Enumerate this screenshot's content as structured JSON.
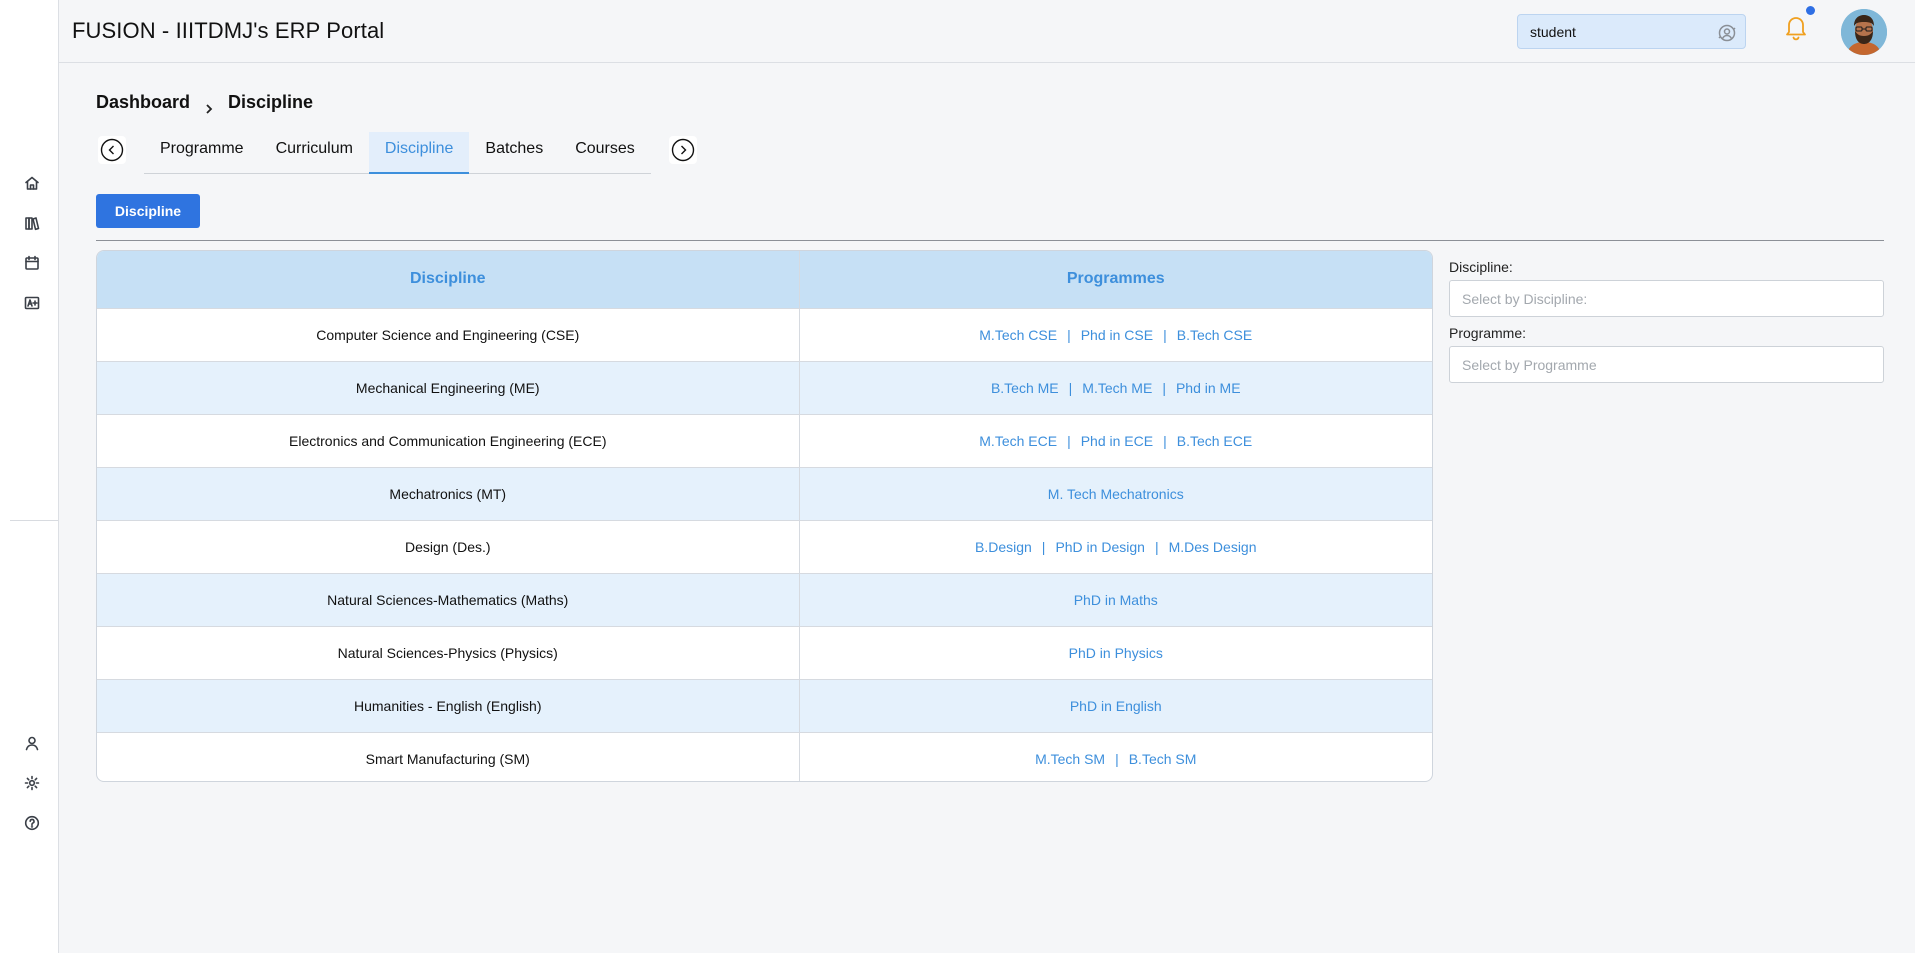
{
  "header": {
    "title": "FUSION - IIITDMJ's ERP Portal",
    "role_value": "student",
    "role_icon": "user-switch-icon",
    "notification_icon": "bell-icon",
    "notification_dot_color": "#2f6fe4"
  },
  "sidebar": {
    "top_icons": [
      "home-icon",
      "books-icon",
      "calendar-icon",
      "grade-icon"
    ],
    "bottom_icons": [
      "profile-icon",
      "settings-icon",
      "help-icon"
    ]
  },
  "breadcrumb": {
    "root": "Dashboard",
    "current": "Discipline"
  },
  "tabs": [
    {
      "label": "Programme",
      "active": false
    },
    {
      "label": "Curriculum",
      "active": false
    },
    {
      "label": "Discipline",
      "active": true
    },
    {
      "label": "Batches",
      "active": false
    },
    {
      "label": "Courses",
      "active": false
    }
  ],
  "action_button": "Discipline",
  "table": {
    "headers": [
      "Discipline",
      "Programmes"
    ],
    "rows": [
      {
        "discipline": "Computer Science and Engineering (CSE)",
        "programmes": [
          "M.Tech CSE",
          "Phd in CSE",
          "B.Tech CSE"
        ]
      },
      {
        "discipline": "Mechanical Engineering (ME)",
        "programmes": [
          "B.Tech ME",
          "M.Tech ME",
          "Phd in ME"
        ]
      },
      {
        "discipline": "Electronics and Communication Engineering (ECE)",
        "programmes": [
          "M.Tech ECE",
          "Phd in ECE",
          "B.Tech ECE"
        ]
      },
      {
        "discipline": "Mechatronics (MT)",
        "programmes": [
          "M. Tech Mechatronics"
        ]
      },
      {
        "discipline": "Design (Des.)",
        "programmes": [
          "B.Design",
          "PhD in Design",
          "M.Des Design"
        ]
      },
      {
        "discipline": "Natural Sciences-Mathematics (Maths)",
        "programmes": [
          "PhD in Maths"
        ]
      },
      {
        "discipline": "Natural Sciences-Physics (Physics)",
        "programmes": [
          "PhD in Physics"
        ]
      },
      {
        "discipline": "Humanities - English (English)",
        "programmes": [
          "PhD in English"
        ]
      },
      {
        "discipline": "Smart Manufacturing (SM)",
        "programmes": [
          "M.Tech SM",
          "B.Tech SM"
        ]
      }
    ]
  },
  "filters": {
    "discipline_label": "Discipline:",
    "discipline_placeholder": "Select by Discipline:",
    "programme_label": "Programme:",
    "programme_placeholder": "Select by Programme"
  },
  "colors": {
    "accent": "#3d8fdc",
    "button": "#2f74e0",
    "header_row": "#c6e0f5",
    "alt_row": "#e5f1fc",
    "bell": "#f0a020"
  }
}
